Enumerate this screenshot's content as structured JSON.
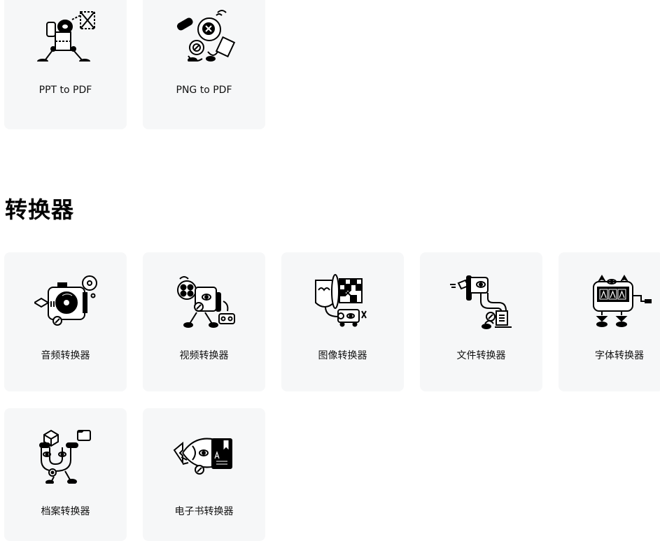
{
  "top_row": [
    {
      "label": "PPT to PDF",
      "icon": "ppt-to-pdf-illustration-icon"
    },
    {
      "label": "PNG to PDF",
      "icon": "png-to-pdf-illustration-icon"
    }
  ],
  "converters": {
    "title": "转换器",
    "items": [
      {
        "label": "音频转换器",
        "icon": "audio-converter-illustration-icon"
      },
      {
        "label": "视频转换器",
        "icon": "video-converter-illustration-icon"
      },
      {
        "label": "图像转换器",
        "icon": "image-converter-illustration-icon"
      },
      {
        "label": "文件转换器",
        "icon": "document-converter-illustration-icon"
      },
      {
        "label": "字体转换器",
        "icon": "font-converter-illustration-icon"
      },
      {
        "label": "档案转换器",
        "icon": "archive-converter-illustration-icon"
      },
      {
        "label": "电子书转换器",
        "icon": "ebook-converter-illustration-icon"
      }
    ]
  },
  "colors": {
    "card_bg": "#f6f7f8",
    "text": "#111111",
    "line": "#000000"
  }
}
